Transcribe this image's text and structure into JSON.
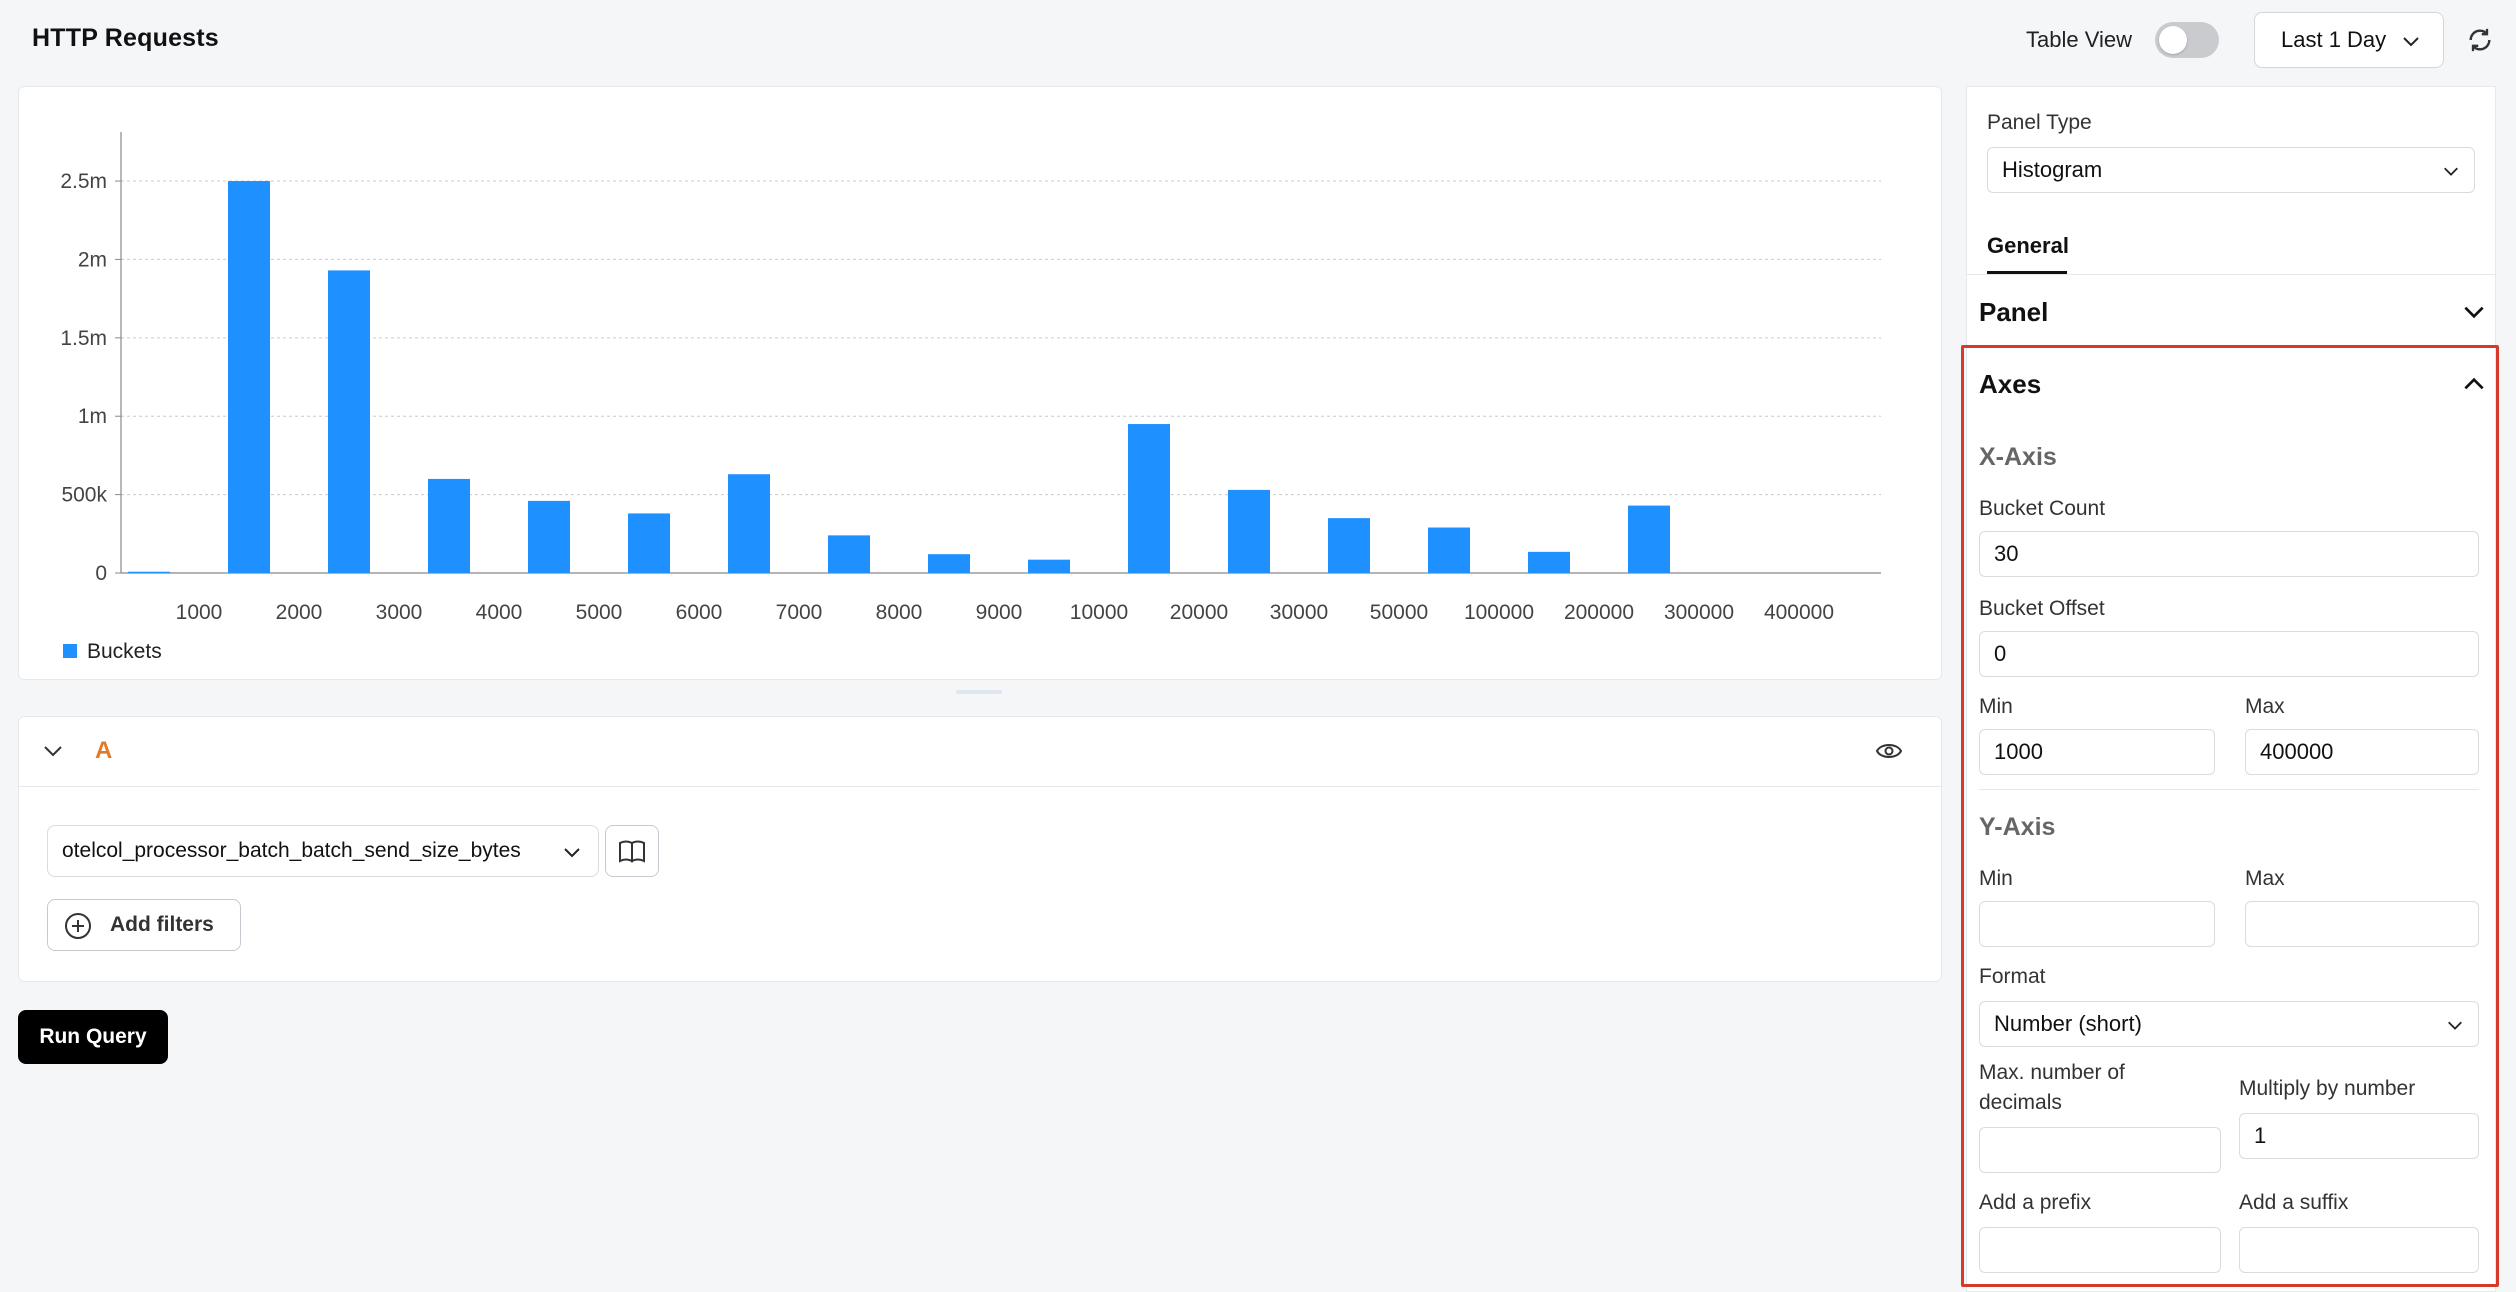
{
  "header": {
    "title": "HTTP Requests",
    "table_view_label": "Table View",
    "table_view_on": false,
    "time_range": "Last 1 Day"
  },
  "chart_data": {
    "type": "bar",
    "categories": [
      "",
      "1000",
      "2000",
      "3000",
      "4000",
      "5000",
      "6000",
      "7000",
      "8000",
      "9000",
      "10000",
      "20000",
      "30000",
      "50000",
      "100000",
      "200000",
      "300000",
      "400000"
    ],
    "series": [
      {
        "name": "Buckets",
        "values": [
          8000,
          2500000,
          1930000,
          600000,
          460000,
          380000,
          630000,
          240000,
          120000,
          85000,
          950000,
          530000,
          350000,
          290000,
          135000,
          430000,
          0,
          0
        ]
      }
    ],
    "y_ticks": [
      "0",
      "500k",
      "1m",
      "1.5m",
      "2m",
      "2.5m"
    ],
    "ylim": [
      0,
      2800000
    ],
    "grid": true,
    "legend_position": "bottom-left",
    "bar_color": "#1e90ff"
  },
  "query": {
    "letter": "A",
    "metric": "otelcol_processor_batch_batch_send_size_bytes",
    "add_filters_label": "Add filters"
  },
  "run_query_label": "Run Query",
  "side": {
    "panel_type_label": "Panel Type",
    "panel_type_value": "Histogram",
    "tab_general": "General",
    "panel_section": "Panel",
    "axes_section": "Axes",
    "x_axis": {
      "title": "X-Axis",
      "bucket_count_label": "Bucket Count",
      "bucket_count_value": "30",
      "bucket_offset_label": "Bucket Offset",
      "bucket_offset_value": "0",
      "min_label": "Min",
      "min_value": "1000",
      "max_label": "Max",
      "max_value": "400000"
    },
    "y_axis": {
      "title": "Y-Axis",
      "min_label": "Min",
      "min_value": "",
      "max_label": "Max",
      "max_value": "",
      "format_label": "Format",
      "format_value": "Number (short)",
      "decimals_label_1": "Max. number of",
      "decimals_label_2": "decimals",
      "decimals_value": "",
      "multiply_label": "Multiply by number",
      "multiply_value": "1",
      "prefix_label": "Add a prefix",
      "prefix_value": "",
      "suffix_label": "Add a suffix",
      "suffix_value": ""
    }
  },
  "colors": {
    "accent": "#1e90ff",
    "query_letter": "#e07b2a",
    "highlight_border": "#d63a2a"
  }
}
